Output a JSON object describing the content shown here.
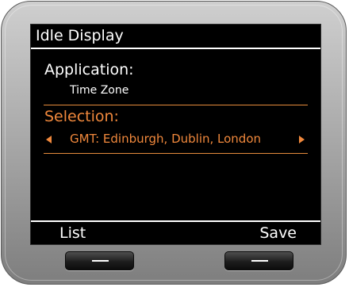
{
  "screen": {
    "title": "Idle Display",
    "application": {
      "label": "Application:",
      "value": "Time Zone"
    },
    "selection": {
      "label": "Selection:",
      "value": "GMT: Edinburgh, Dublin, London",
      "prev_icon": "triangle-left-icon",
      "next_icon": "triangle-right-icon"
    },
    "softkeys": {
      "left": "List",
      "right": "Save"
    }
  },
  "hardware": {
    "left_button_icon": "dash-icon",
    "right_button_icon": "dash-icon"
  },
  "colors": {
    "screen_background": "#000000",
    "text": "#ffffff",
    "accent": "#f0883c",
    "device_body": "#a9a9a9"
  }
}
